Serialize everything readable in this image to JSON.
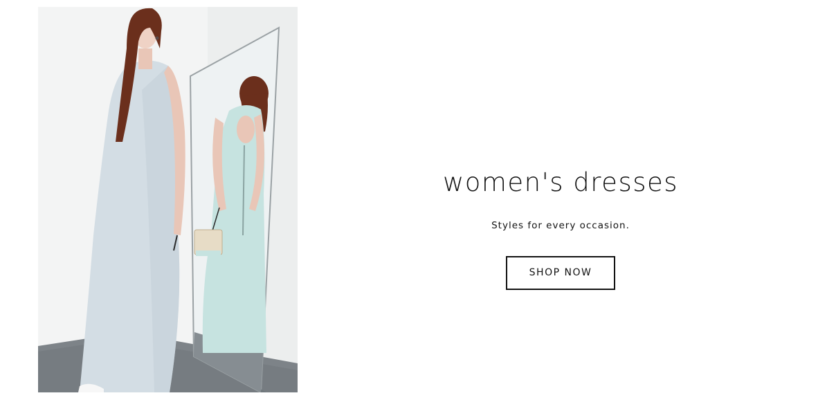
{
  "hero": {
    "image_alt": "Model in a long pale blue sleeveless dress posing beside a leaning mirror that reflects the open back and a small cream shoulder bag",
    "colors": {
      "background": "#f3f4f4",
      "floor": "#7d8388",
      "dress": "#d3dde4",
      "dress_reflection": "#c6e3e0",
      "hair": "#6b2f1c",
      "skin": "#e9c6b7",
      "bag": "#e7dcc6"
    }
  },
  "promo": {
    "title": "women's dresses",
    "subtitle": "Styles for every occasion.",
    "cta_label": "SHOP NOW"
  }
}
